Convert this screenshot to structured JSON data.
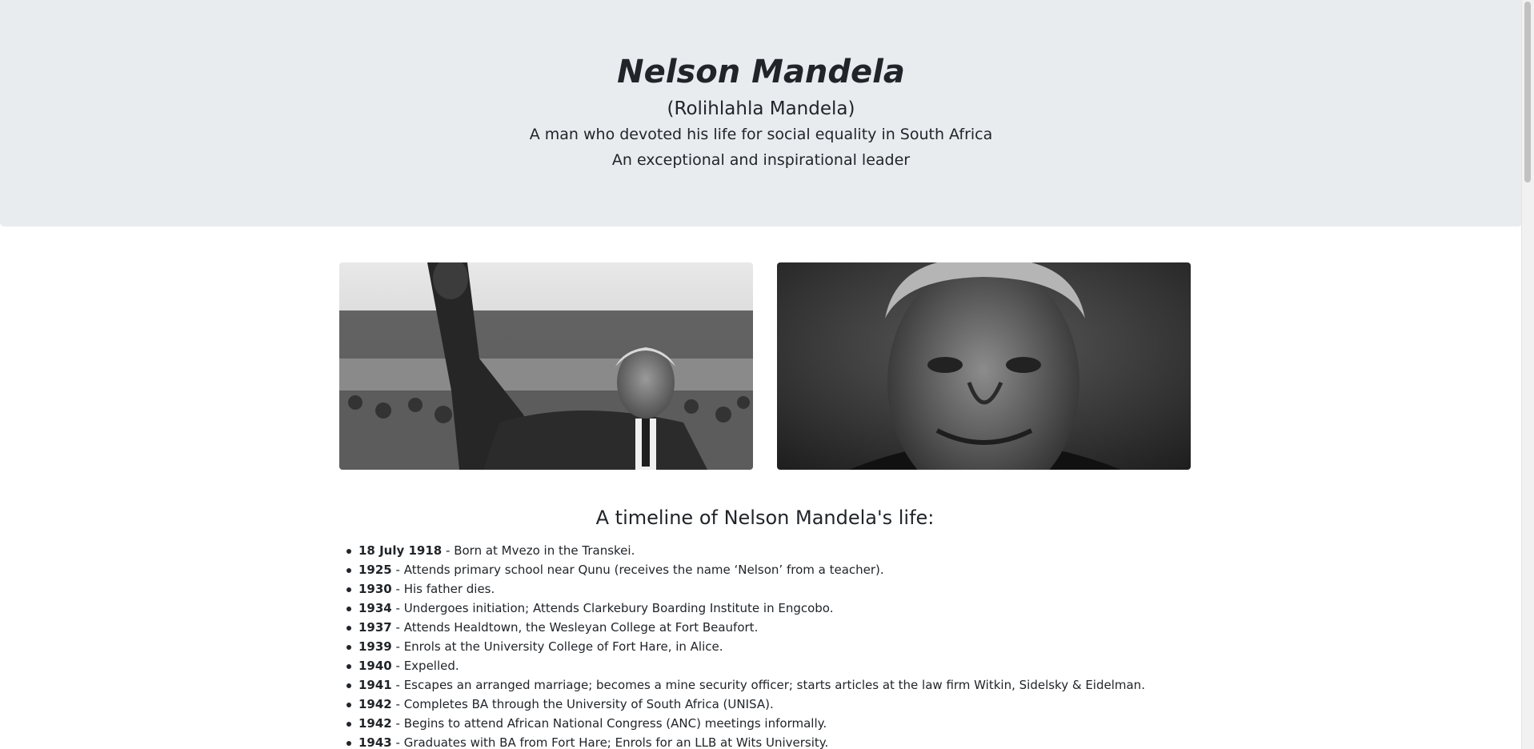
{
  "header": {
    "title": "Nelson Mandela",
    "subtitle": "(Rolihlahla Mandela)",
    "tagline_1": "A man who devoted his life for social equality in South Africa",
    "tagline_2": "An exceptional and inspirational leader"
  },
  "images": [
    {
      "name": "mandela-rally-photo",
      "alt": "Nelson Mandela raising fist at rally"
    },
    {
      "name": "mandela-portrait-photo",
      "alt": "Portrait of Nelson Mandela"
    }
  ],
  "timeline": {
    "heading": "A timeline of Nelson Mandela's life:",
    "items": [
      {
        "date": "18 July 1918",
        "text": " - Born at Mvezo in the Transkei."
      },
      {
        "date": "1925",
        "text": " - Attends primary school near Qunu (receives the name ‘Nelson’ from a teacher)."
      },
      {
        "date": "1930",
        "text": " - His father dies."
      },
      {
        "date": "1934",
        "text": " - Undergoes initiation; Attends Clarkebury Boarding Institute in Engcobo."
      },
      {
        "date": "1937",
        "text": " - Attends Healdtown, the Wesleyan College at Fort Beaufort."
      },
      {
        "date": "1939",
        "text": " - Enrols at the University College of Fort Hare, in Alice."
      },
      {
        "date": "1940",
        "text": " - Expelled."
      },
      {
        "date": "1941",
        "text": " - Escapes an arranged marriage; becomes a mine security officer; starts articles at the law firm Witkin, Sidelsky & Eidelman."
      },
      {
        "date": "1942",
        "text": " - Completes BA through the University of South Africa (UNISA)."
      },
      {
        "date": "1942",
        "text": " - Begins to attend African National Congress (ANC) meetings informally."
      },
      {
        "date": "1943",
        "text": " - Graduates with BA from Fort Hare; Enrols for an LLB at Wits University."
      }
    ]
  },
  "colors": {
    "jumbotron_bg": "#e9ecef",
    "text": "#212529",
    "page_bg": "#ffffff"
  }
}
